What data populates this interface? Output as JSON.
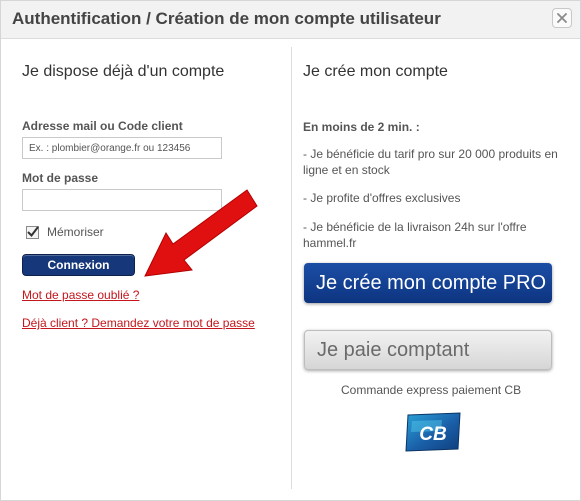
{
  "dialog": {
    "title": "Authentification / Création de mon compte utilisateur",
    "close_icon": "close-icon"
  },
  "login": {
    "heading": "Je dispose déjà d'un compte",
    "email_label": "Adresse mail ou Code client",
    "email_placeholder": "Ex. : plombier@orange.fr ou 123456",
    "email_value": "",
    "password_label": "Mot de passe",
    "password_value": "",
    "remember_label": "Mémoriser",
    "remember_checked": true,
    "submit_label": "Connexion",
    "forgot_link": "Mot de passe oublié ?",
    "existing_client_link": "Déjà client ? Demandez votre mot de passe",
    "annotation_icon": "red-arrow-icon"
  },
  "signup": {
    "heading": "Je crée mon compte",
    "intro": "En moins de 2 min. :",
    "benefits": [
      "- Je bénéficie du tarif pro sur 20 000 produits en ligne et en stock",
      "- Je profite d'offres exclusives",
      "- Je bénéficie de la livraison 24h sur l'offre hammel.fr"
    ],
    "pro_button": "Je crée mon compte PRO",
    "cash_button": "Je paie comptant",
    "express_text": "Commande express paiement CB",
    "cb_logo_text": "CB"
  },
  "colors": {
    "link_red": "#c4161c",
    "button_navy": "#16387a",
    "pro_blue": "#1c4ea6",
    "arrow_red": "#e01010"
  }
}
